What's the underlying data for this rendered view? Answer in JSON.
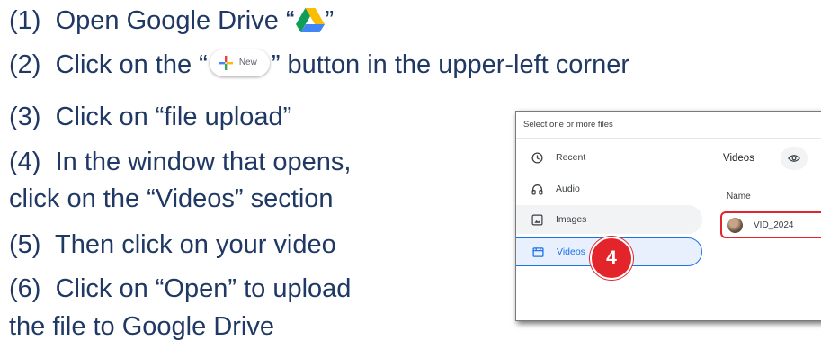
{
  "steps": [
    {
      "num": "(1)",
      "before": "Open Google Drive “",
      "after": "”"
    },
    {
      "num": "(2)",
      "before": "Click on the “",
      "after": "” button in the upper-left corner"
    },
    {
      "num": "(3)",
      "text": "Click on “file upload”"
    },
    {
      "num": "(4)",
      "text": "In the window that opens,",
      "cont": "click on the “Videos” section"
    },
    {
      "num": "(5)",
      "text": "Then click on your video"
    },
    {
      "num": "(6)",
      "text": "Click on “Open” to upload",
      "cont": "the file to Google Drive"
    }
  ],
  "new_button": {
    "label": "New"
  },
  "dialog": {
    "title": "Select one or more files",
    "nav": [
      {
        "label": "Recent",
        "icon": "clock-icon"
      },
      {
        "label": "Audio",
        "icon": "headphones-icon"
      },
      {
        "label": "Images",
        "icon": "image-icon"
      },
      {
        "label": "Videos",
        "icon": "film-icon"
      }
    ],
    "panel_title": "Videos",
    "column_name": "Name",
    "file_name": "VID_2024"
  },
  "badge": {
    "label": "4"
  },
  "colors": {
    "text": "#1f3864",
    "accent": "#1a73e8",
    "highlight": "#e3242b"
  }
}
